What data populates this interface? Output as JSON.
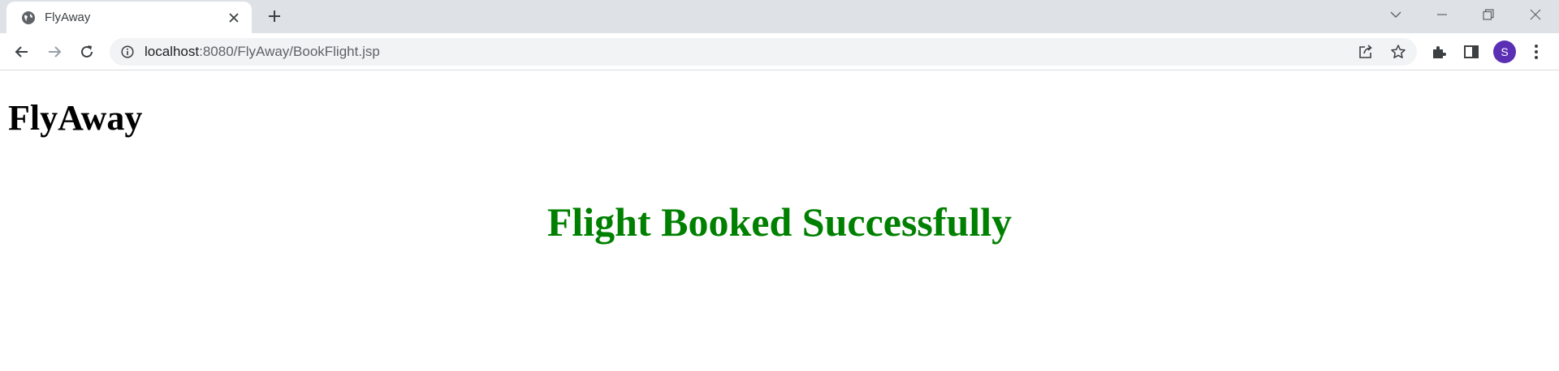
{
  "browser": {
    "tab": {
      "title": "FlyAway",
      "favicon": "globe-icon",
      "close_icon": "close-icon"
    },
    "new_tab_icon": "plus-icon",
    "window_controls": [
      "chevron-down-icon",
      "minimize-icon",
      "restore-icon",
      "close-icon"
    ],
    "toolbar": {
      "back_icon": "arrow-left-icon",
      "forward_icon": "arrow-right-icon",
      "reload_icon": "reload-icon",
      "site_info_icon": "info-icon",
      "url_host": "localhost",
      "url_path": ":8080/FlyAway/BookFlight.jsp",
      "share_icon": "share-icon",
      "bookmark_icon": "star-icon",
      "extensions_icon": "puzzle-icon",
      "side_panel_icon": "side-panel-icon",
      "profile_initial": "S",
      "menu_icon": "kebab-menu-icon"
    },
    "colors": {
      "tabstrip_bg": "#dee1e6",
      "omnibox_bg": "#f1f3f4",
      "avatar_bg": "#5b2fb3"
    }
  },
  "page": {
    "heading": "FlyAway",
    "message": "Flight Booked Successfully",
    "colors": {
      "message": "#008000",
      "heading": "#000000"
    }
  }
}
